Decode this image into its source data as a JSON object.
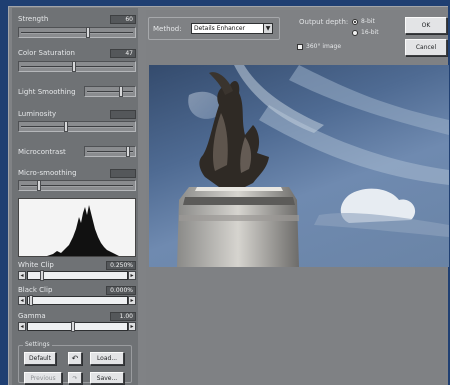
{
  "left_panel": {
    "strength": {
      "label": "Strength",
      "value": "60",
      "level": 0.6
    },
    "color_saturation": {
      "label": "Color Saturation",
      "value": "47",
      "level": 0.47
    },
    "light_smoothing": {
      "label": "Light Smoothing",
      "level": 0.75
    },
    "luminosity": {
      "label": "Luminosity",
      "value": "",
      "level": 0.4
    },
    "microcontrast": {
      "label": "Microcontrast",
      "level": 0.9
    },
    "micro_smoothing": {
      "label": "Micro-smoothing",
      "value": "",
      "level": 0.15
    },
    "white_clip": {
      "label": "White Clip",
      "value": "0.250%",
      "level": 0.12
    },
    "black_clip": {
      "label": "Black Clip",
      "value": "0.000%",
      "level": 0.0
    },
    "gamma": {
      "label": "Gamma",
      "value": "1.00",
      "level": 0.45
    },
    "settings": {
      "label": "Settings",
      "default": "Default",
      "load": "Load...",
      "previous": "Previous",
      "save": "Save..."
    }
  },
  "top_bar": {
    "method_label": "Method:",
    "method_value": "Details Enhancer",
    "output_depth_label": "Output depth:",
    "depth_8": "8-bit",
    "depth_16": "16-bit",
    "depth_selected": "8-bit",
    "checkbox_label": "360° image",
    "ok": "OK",
    "cancel": "Cancel"
  },
  "colors": {
    "desktop": "#1f3f72",
    "window": "#808285",
    "panel": "#6f7275"
  }
}
